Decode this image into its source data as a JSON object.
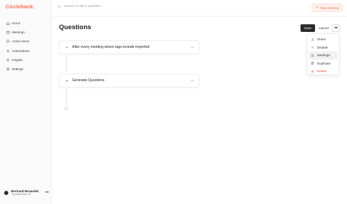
{
  "app": {
    "logo_text": "Circleback.",
    "brand_color": "#ff6b4a"
  },
  "sidebar": {
    "items": [
      {
        "label": "Home",
        "icon": "home-icon"
      },
      {
        "label": "Meetings",
        "icon": "meetings-icon"
      },
      {
        "label": "Action Items",
        "icon": "action-items-icon"
      },
      {
        "label": "Automations",
        "icon": "automations-icon"
      },
      {
        "label": "Insights",
        "icon": "insights-icon"
      },
      {
        "label": "Settings",
        "icon": "settings-icon"
      }
    ],
    "user": {
      "name": "Bertrand Bruandet",
      "subtitle": "Tryrands Sep 25"
    }
  },
  "topbar": {
    "search_placeholder": "Search or ask a question...",
    "new_meeting_label": "New meeting"
  },
  "page": {
    "title": "Questions",
    "save_label": "Save",
    "cancel_label": "Cancel",
    "more_label": "•••"
  },
  "workflow": {
    "trigger_label": "After every meeting where tags include imported",
    "action_label": "Generate Questions"
  },
  "menu": {
    "items": [
      {
        "label": "Share",
        "icon": "share-icon"
      },
      {
        "label": "Disable",
        "icon": "close-icon"
      },
      {
        "label": "Meetings",
        "icon": "meetings-icon"
      },
      {
        "label": "Duplicate",
        "icon": "duplicate-icon"
      },
      {
        "label": "Delete",
        "icon": "trash-icon"
      }
    ],
    "highlighted_item": "Meetings",
    "danger_color": "#e5483b"
  }
}
